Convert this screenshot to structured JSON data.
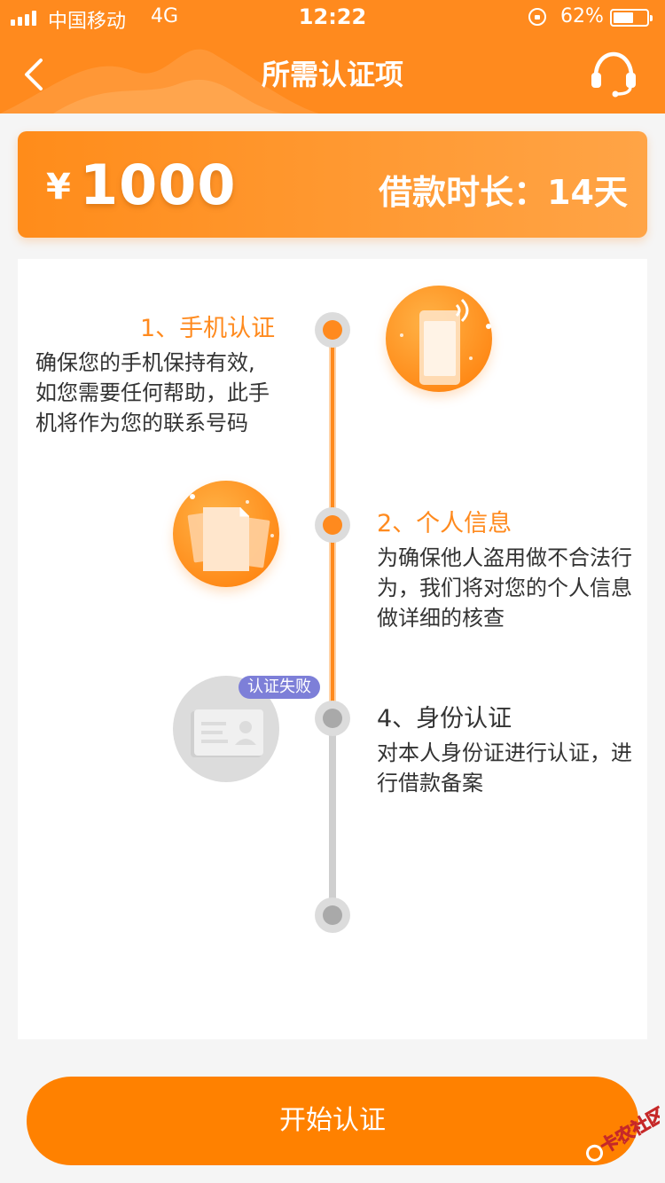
{
  "status_bar": {
    "carrier": "中国移动",
    "network": "4G",
    "time": "12:22",
    "battery_percent": "62%",
    "battery_level": 0.62,
    "lock_icon": "orientation-lock-icon"
  },
  "nav": {
    "title": "所需认证项",
    "back_icon": "chevron-left-icon",
    "service_icon": "headset-icon"
  },
  "loan": {
    "currency": "¥",
    "amount": "1000",
    "term_label": "借款时长：14天"
  },
  "steps": [
    {
      "title": "1、手机认证",
      "desc_lines": [
        "确保您的手机保持有效,",
        "如您需要任何帮助，此手",
        "机将作为您的联系号码"
      ],
      "icon": "phone-icon",
      "state": "active"
    },
    {
      "title": "2、个人信息",
      "desc_lines": [
        "为确保他人盗用做不合法行",
        "为，我们将对您的个人信息",
        "做详细的核查"
      ],
      "icon": "documents-icon",
      "state": "active"
    },
    {
      "title": "4、身份认证",
      "desc_lines": [
        "对本人身份证进行认证，进",
        "行借款备案"
      ],
      "icon": "id-card-icon",
      "state": "inactive",
      "badge": "认证失败"
    }
  ],
  "start_button": {
    "label": "开始认证"
  },
  "watermark": {
    "text": "卡农社区"
  },
  "colors": {
    "accent": "#ff8a1e",
    "badge": "#7d7fd8",
    "inactive": "#dcdcdc"
  }
}
